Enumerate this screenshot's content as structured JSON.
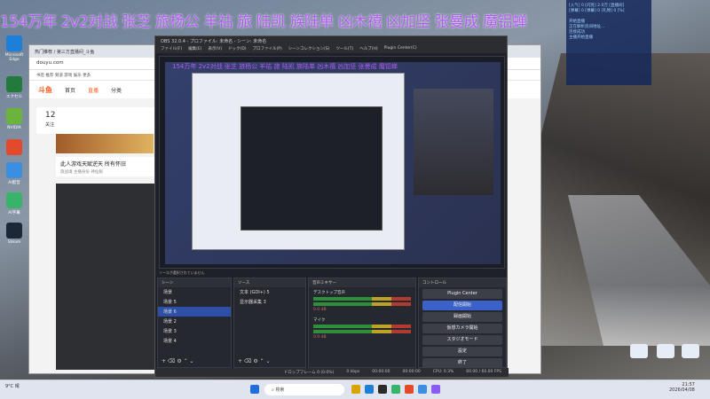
{
  "banner": {
    "text": "154万年 2v2对战 张芝 旅杨公 羊祜 旅 陆凯 族陆单 凶木禧 凶加坚 张曼成 魔铝蝉"
  },
  "desktop_icons": [
    "Microsoft Edge",
    "エクセル",
    "NVIDIA",
    "AI配音",
    "AI字幕",
    "Steam",
    "AI配音"
  ],
  "browser": {
    "tab_title": "热门推荐 / 第三方直播间_斗鱼",
    "url": "douyu.com",
    "bookmarks": "书签  推荐  频道  游戏  娱乐  更多",
    "nav": [
      "首页",
      "直播",
      "分类"
    ],
    "logo": "斗鱼",
    "stats": {
      "count": "12",
      "label": "关注"
    },
    "streamer_title": "此人游戏天赋逆天 所有怀旧",
    "streamer_sub": "旅战魂 主播身份 神仙魁"
  },
  "obs": {
    "title": "OBS 32.0.4 - プロファイル: 未命名 - シーン: 未命名",
    "menu": [
      "ファイル(F)",
      "編集(E)",
      "表示(V)",
      "ドック(D)",
      "プロファイル(P)",
      "シーンコレクション(S)",
      "ツール(T)",
      "ヘルプ(H)",
      "Plugin Center(C)"
    ],
    "toolbar_hint": "ソースが選択されていません",
    "scenes_title": "シーン",
    "scenes": [
      "场景",
      "场景 5",
      "场景 6",
      "场景 2",
      "场景 3",
      "场景 4"
    ],
    "selected_scene": 2,
    "sources_title": "ソース",
    "sources": [
      "文本 (GDI+) 5",
      "显示器采集 3"
    ],
    "mixer_title": "音声ミキサー",
    "mixer": [
      {
        "name": "デスクトップ音声",
        "db": "0.0 dB"
      },
      {
        "name": "マイク",
        "db": "0.0 dB"
      }
    ],
    "controls_title": "コントロール",
    "controls": [
      "Plugin Center",
      "配信開始",
      "録画開始",
      "仮想カメラ開始",
      "スタジオモード",
      "設定",
      "終了"
    ],
    "status": {
      "frames": "ドロップフレーム 0 (0.0%)",
      "kbps": "0 kbps",
      "rec": "00:00:00",
      "live": "00:00:00",
      "cpu": "CPU: 0.3%",
      "fps": "60.00 / 60.00 FPS"
    }
  },
  "panel": {
    "lines": [
      "[入气] 0 [闪亮] 2.0万 [直播间]",
      "[弹幕] 0 [弹幕] 0 [礼物] 0 [%]",
      "开始直播",
      "正在解析房间地址...",
      "连接成功",
      "主播开始直播"
    ]
  },
  "taskbar": {
    "weather": "9°C 晴",
    "search": "検索",
    "time": "21:57",
    "date": "2026/04/08"
  },
  "colors": {
    "accent": "#3a62c8",
    "douyu": "#ff5d23",
    "banner": "#b05cf0"
  }
}
